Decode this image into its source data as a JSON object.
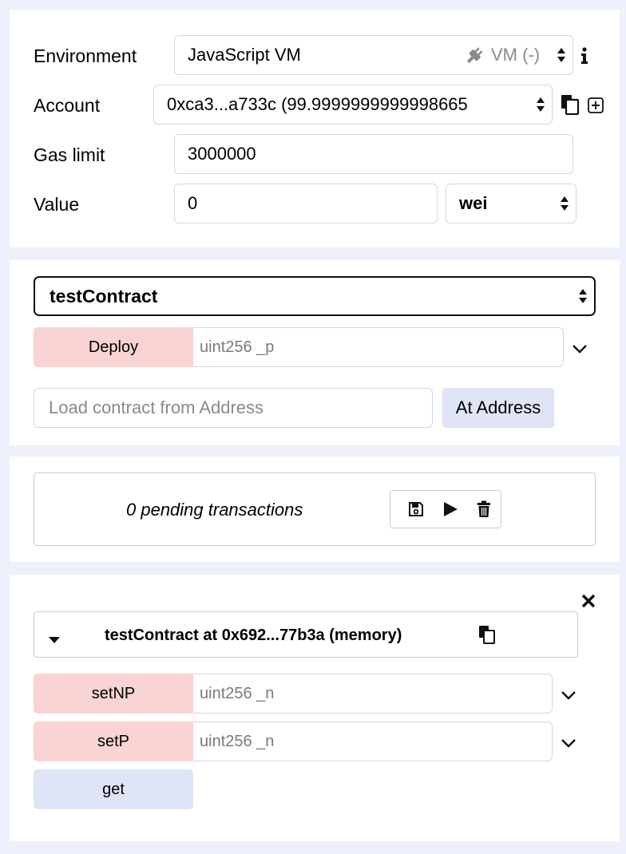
{
  "settings": {
    "environment_label": "Environment",
    "environment_value": "JavaScript VM",
    "environment_badge": "VM (-)",
    "account_label": "Account",
    "account_value": "0xca3...a733c (99.9999999999998665",
    "gas_limit_label": "Gas limit",
    "gas_limit_value": "3000000",
    "value_label": "Value",
    "value_value": "0",
    "unit_value": "wei"
  },
  "deploy": {
    "contract_select": "testContract",
    "deploy_label": "Deploy",
    "deploy_param_placeholder": "uint256 _p",
    "address_placeholder": "Load contract from Address",
    "at_address_label": "At Address"
  },
  "pending": {
    "text": "0 pending transactions"
  },
  "instance": {
    "title": "testContract at 0x692...77b3a (memory)",
    "functions": [
      {
        "label": "setNP",
        "placeholder": "uint256 _n"
      },
      {
        "label": "setP",
        "placeholder": "uint256 _n"
      },
      {
        "label": "get"
      }
    ]
  },
  "colors": {
    "accent_red": "#f8d4d4",
    "accent_blue": "#dfe5f7",
    "background": "#eef1fb"
  }
}
